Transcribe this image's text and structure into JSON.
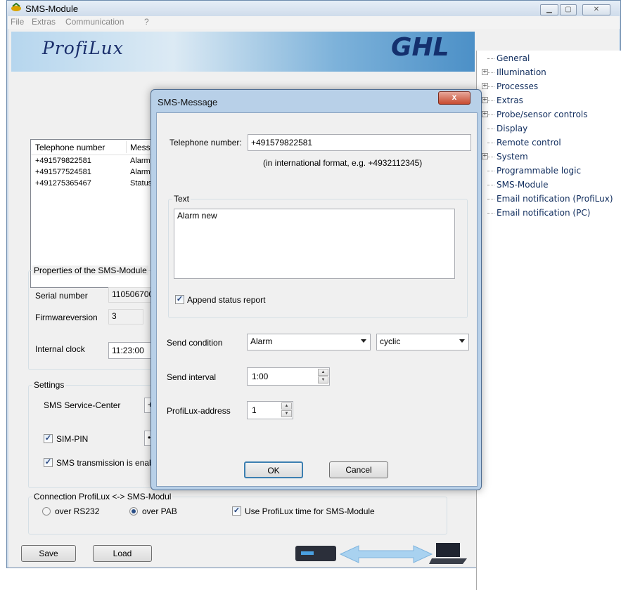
{
  "window": {
    "title": "SMS-Module"
  },
  "menu": [
    "File",
    "Extras",
    "Communication",
    "?"
  ],
  "banner": {
    "left_logo": "ProfiLux",
    "right_logo": "GHL"
  },
  "tree": [
    {
      "label": "General",
      "expandable": false
    },
    {
      "label": "Illumination",
      "expandable": true
    },
    {
      "label": "Processes",
      "expandable": true
    },
    {
      "label": "Extras",
      "expandable": true
    },
    {
      "label": "Probe/sensor controls",
      "expandable": true
    },
    {
      "label": "Display",
      "expandable": false
    },
    {
      "label": "Remote control",
      "expandable": false
    },
    {
      "label": "System",
      "expandable": true
    },
    {
      "label": "Programmable logic",
      "expandable": false
    },
    {
      "label": "SMS-Module",
      "expandable": false
    },
    {
      "label": "Email notification (ProfiLux)",
      "expandable": false
    },
    {
      "label": "Email notification (PC)",
      "expandable": false
    }
  ],
  "list": {
    "columns": [
      "Telephone number",
      "Messa"
    ],
    "rows": [
      [
        "+491579822581",
        "Alarm"
      ],
      [
        "+491577524581",
        "Alarm"
      ],
      [
        "+491275365467",
        "Status"
      ]
    ]
  },
  "properties": {
    "title": "Properties of the SMS-Module",
    "serial_label": "Serial number",
    "serial_value": "110506700",
    "firmware_label": "Firmwareversion",
    "firmware_value": "3",
    "clock_label": "Internal clock",
    "clock_value": "11:23:00"
  },
  "settings": {
    "title": "Settings",
    "service_center_label": "SMS Service-Center",
    "service_center_value": "+4",
    "sim_pin_label": "SIM-PIN",
    "sim_pin_value": "•",
    "transmission_label": "SMS transmission is enab"
  },
  "connection": {
    "title": "Connection ProfiLux <-> SMS-Modul",
    "rs232": "over RS232",
    "pab": "over PAB",
    "use_time": "Use ProfiLux time for SMS-Module"
  },
  "buttons": {
    "save": "Save",
    "load": "Load"
  },
  "dialog": {
    "title": "SMS-Message",
    "close": "x",
    "phone_label": "Telephone number:",
    "phone_value": "+491579822581",
    "phone_hint": "(in international format, e.g. +4932112345)",
    "text_group": "Text",
    "text_value": "Alarm new",
    "append_label": "Append status report",
    "send_condition_label": "Send condition",
    "send_condition_value": "Alarm",
    "send_mode_value": "cyclic",
    "send_interval_label": "Send interval",
    "send_interval_value": "1:00",
    "address_label": "ProfiLux-address",
    "address_value": "1",
    "ok": "OK",
    "cancel": "Cancel"
  },
  "colors": {
    "accent": "#4c90c7",
    "tree_text": "#0e2b5c",
    "close_button": "#c74b30"
  }
}
